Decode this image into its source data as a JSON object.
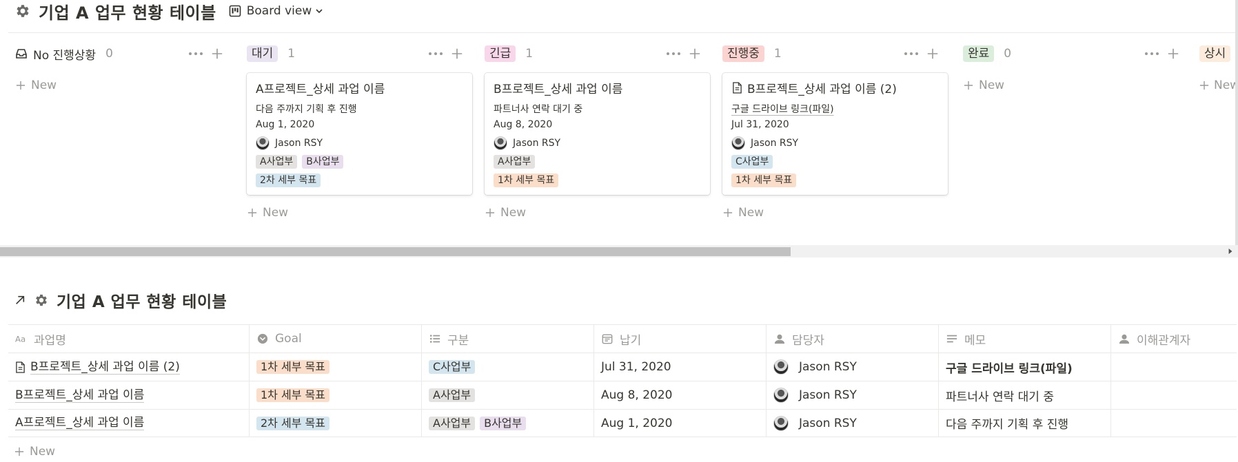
{
  "board": {
    "title": "기업 A 업무 현황 테이블",
    "view_label": "Board view",
    "new_label": "New",
    "columns": [
      {
        "label": "No 진행상황",
        "count": "0",
        "tag_bg": "",
        "tag_color": "#37352f"
      },
      {
        "label": "대기",
        "count": "1",
        "tag_bg": "#eae4f2",
        "tag_color": "#37352f"
      },
      {
        "label": "긴급",
        "count": "1",
        "tag_bg": "#f9d7ea",
        "tag_color": "#37352f"
      },
      {
        "label": "진행중",
        "count": "1",
        "tag_bg": "#fbd3d1",
        "tag_color": "#37352f"
      },
      {
        "label": "완료",
        "count": "0",
        "tag_bg": "#dbeddb",
        "tag_color": "#37352f"
      },
      {
        "label": "상시",
        "count": "",
        "tag_bg": "#fbecdd",
        "tag_color": "#37352f"
      }
    ],
    "cards": [
      {
        "title": "A프로젝트_상세 과업 이름",
        "memo": "다음 주까지 기획 후 진행",
        "date": "Aug 1, 2020",
        "person": "Jason RSY",
        "dept_tags": [
          "A사업부",
          "B사업부"
        ],
        "goal_tag": "2차 세부 목표"
      },
      {
        "title": "B프로젝트_상세 과업 이름",
        "memo": "파트너사 연락 대기 중",
        "date": "Aug 8, 2020",
        "person": "Jason RSY",
        "dept_tags": [
          "A사업부"
        ],
        "goal_tag": "1차 세부 목표"
      },
      {
        "title": "B프로젝트_상세 과업 이름 (2)",
        "memo": "구글 드라이브 링크(파일)",
        "date": "Jul 31, 2020",
        "person": "Jason RSY",
        "dept_tags": [
          "C사업부"
        ],
        "goal_tag": "1차 세부 목표"
      }
    ]
  },
  "table": {
    "title": "기업 A 업무 현황 테이블",
    "headers": [
      "과업명",
      "Goal",
      "구분",
      "납기",
      "담당자",
      "메모",
      "이해관계자"
    ],
    "rows": [
      {
        "name": "B프로젝트_상세 과업 이름 (2)",
        "goal": "1차 세부 목표",
        "depts": [
          "C사업부"
        ],
        "date": "Jul 31, 2020",
        "person": "Jason RSY",
        "memo": "구글 드라이브 링크(파일)"
      },
      {
        "name": "B프로젝트_상세 과업 이름",
        "goal": "1차 세부 목표",
        "depts": [
          "A사업부"
        ],
        "date": "Aug 8, 2020",
        "person": "Jason RSY",
        "memo": "파트너사 연락 대기 중"
      },
      {
        "name": "A프로젝트_상세 과업 이름",
        "goal": "2차 세부 목표",
        "depts": [
          "A사업부",
          "B사업부"
        ],
        "date": "Aug 1, 2020",
        "person": "Jason RSY",
        "memo": "다음 주까지 기획 후 진행"
      }
    ],
    "new_label": "New"
  },
  "colors": {
    "tag_gray": "#e3e2e0",
    "tag_purple": "#e8deee",
    "tag_blue": "#d3e5ef",
    "tag_orange": "#fadec9",
    "muted_text": "#9b9a97",
    "text": "#37352f",
    "divider": "#e9e9e7"
  }
}
